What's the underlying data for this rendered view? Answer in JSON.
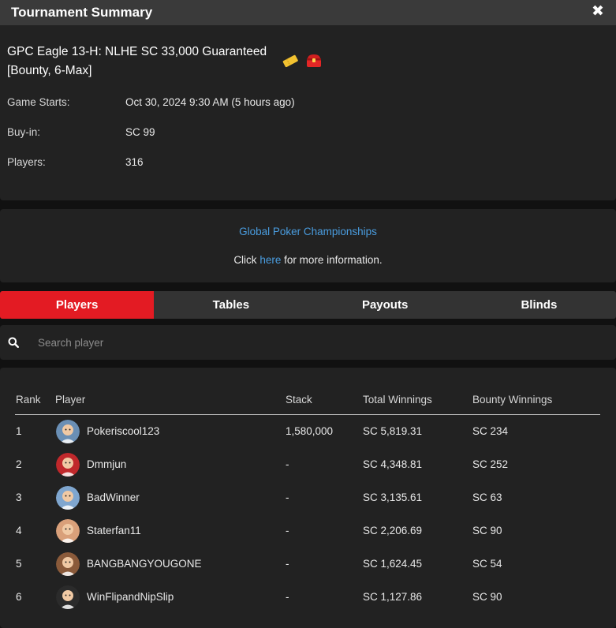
{
  "header": {
    "title": "Tournament Summary",
    "close_icon": "close-icon"
  },
  "tournament": {
    "name": "GPC Eagle 13-H: NLHE SC 33,000 Guaranteed [Bounty, 6-Max]",
    "badges": [
      "ticket-icon",
      "bounty-chest-icon"
    ],
    "rows": [
      {
        "label": "Game Starts:",
        "value": "Oct 30, 2024 9:30 AM (5 hours ago)"
      },
      {
        "label": "Buy-in:",
        "value": "SC 99"
      },
      {
        "label": "Players:",
        "value": "316"
      }
    ]
  },
  "promo": {
    "link_text": "Global Poker Championships",
    "prefix": "Click",
    "here": "here",
    "suffix": "for more information."
  },
  "tabs": [
    {
      "label": "Players",
      "active": true
    },
    {
      "label": "Tables",
      "active": false
    },
    {
      "label": "Payouts",
      "active": false
    },
    {
      "label": "Blinds",
      "active": false
    }
  ],
  "search": {
    "placeholder": "Search player",
    "value": "",
    "icon": "search-icon"
  },
  "table": {
    "columns": [
      "Rank",
      "Player",
      "Stack",
      "Total Winnings",
      "Bounty Winnings"
    ],
    "rows": [
      {
        "rank": "1",
        "player": "Pokeriscool123",
        "stack": "1,580,000",
        "total": "SC 5,819.31",
        "bounty": "SC 234",
        "avatar_color": "#6a8fb5"
      },
      {
        "rank": "2",
        "player": "Dmmjun",
        "stack": "-",
        "total": "SC 4,348.81",
        "bounty": "SC 252",
        "avatar_color": "#c0282b"
      },
      {
        "rank": "3",
        "player": "BadWinner",
        "stack": "-",
        "total": "SC 3,135.61",
        "bounty": "SC 63",
        "avatar_color": "#7fa6cf"
      },
      {
        "rank": "4",
        "player": "Staterfan11",
        "stack": "-",
        "total": "SC 2,206.69",
        "bounty": "SC 90",
        "avatar_color": "#d9a07a"
      },
      {
        "rank": "5",
        "player": "BANGBANGYOUGONE",
        "stack": "-",
        "total": "SC 1,624.45",
        "bounty": "SC 54",
        "avatar_color": "#8a5a3a"
      },
      {
        "rank": "6",
        "player": "WinFlipandNipSlip",
        "stack": "-",
        "total": "SC 1,127.86",
        "bounty": "SC 90",
        "avatar_color": "#2b2b2b"
      }
    ]
  },
  "colors": {
    "accent": "#e31b23",
    "link": "#4a9de0",
    "panel": "#222222",
    "background": "#111111"
  }
}
